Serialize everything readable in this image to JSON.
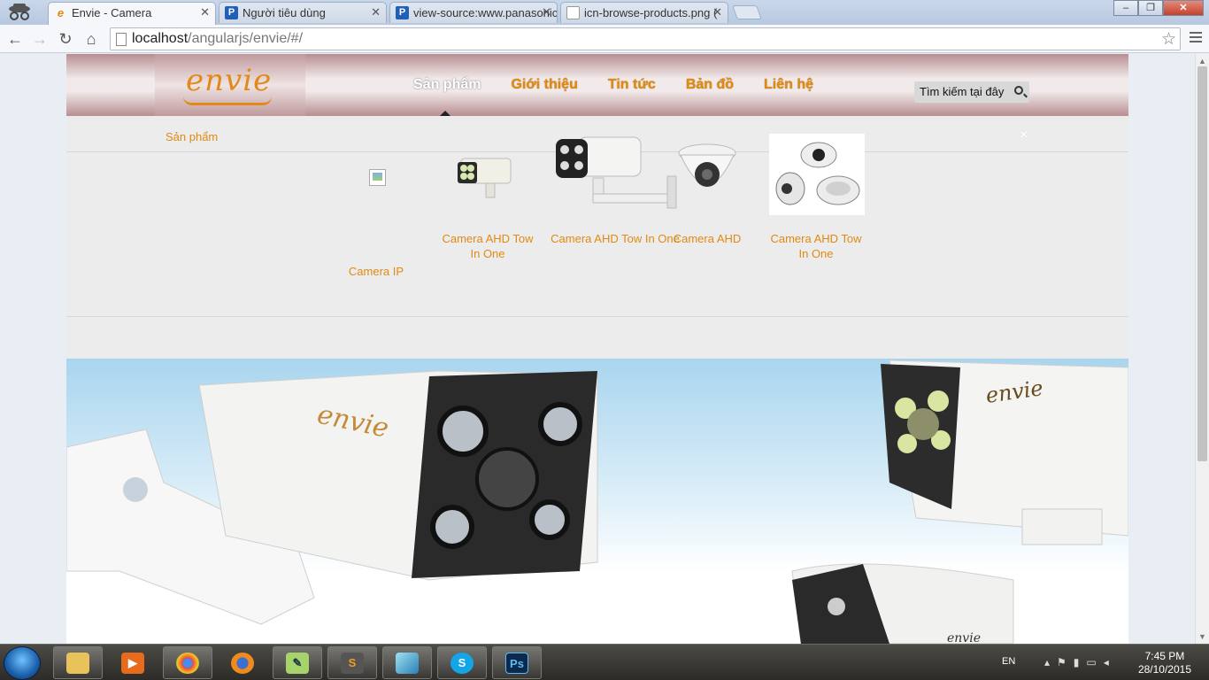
{
  "browser": {
    "tabs": [
      {
        "title": "Envie - Camera",
        "icon": "envie-favicon"
      },
      {
        "title": "Người tiêu dùng",
        "icon": "p-favicon"
      },
      {
        "title": "view-source:www.panasonic",
        "icon": "p-favicon"
      },
      {
        "title": "icn-browse-products.png (",
        "icon": "page-favicon"
      }
    ],
    "url_host": "localhost",
    "url_path": "/angularjs/envie/#/"
  },
  "site": {
    "logo": "envie",
    "nav": [
      {
        "label": "Sản phẩm",
        "active": true
      },
      {
        "label": "Giới thiệu"
      },
      {
        "label": "Tin tức"
      },
      {
        "label": "Bản đồ"
      },
      {
        "label": "Liên hệ"
      }
    ],
    "search_placeholder": "Tìm kiếm tại đây",
    "dropdown": {
      "title": "Sản phẩm",
      "close": "×",
      "products": [
        {
          "title": "Camera IP"
        },
        {
          "title": "Camera AHD Tow In One"
        },
        {
          "title": "Camera AHD Tow In One"
        },
        {
          "title": "Camera AHD"
        },
        {
          "title": "Camera AHD Tow In One"
        }
      ]
    },
    "banner": {
      "camera_brand": "envie"
    },
    "colors": {
      "accent": "#e08a12",
      "topbar": "#b88e91"
    }
  },
  "taskbar": {
    "lang": "EN",
    "time": "7:45 PM",
    "date": "28/10/2015",
    "apps": [
      "explorer",
      "media-player",
      "chrome",
      "firefox",
      "notepad-plus",
      "sublime",
      "app",
      "skype",
      "photoshop"
    ]
  }
}
